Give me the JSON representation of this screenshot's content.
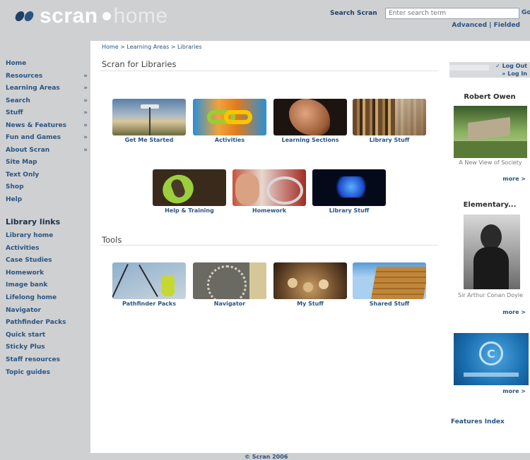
{
  "header": {
    "logo_text": "scran",
    "logo_home": "home",
    "search_label": "Search Scran",
    "search_placeholder": "Enter search term",
    "search_go": "Go",
    "links": "Advanced | Fielded"
  },
  "left_nav": {
    "items": [
      {
        "label": "Home",
        "arrow": ""
      },
      {
        "label": "Resources",
        "arrow": "»"
      },
      {
        "label": "Learning Areas",
        "arrow": "»"
      },
      {
        "label": "Search",
        "arrow": "»"
      },
      {
        "label": "Stuff",
        "arrow": "»"
      },
      {
        "label": "News & Features",
        "arrow": "»"
      },
      {
        "label": "Fun and Games",
        "arrow": "»"
      },
      {
        "label": "About Scran",
        "arrow": "»"
      },
      {
        "label": "Site Map",
        "arrow": ""
      },
      {
        "label": "Text Only",
        "arrow": ""
      },
      {
        "label": "Shop",
        "arrow": ""
      },
      {
        "label": "Help",
        "arrow": ""
      }
    ],
    "library_heading": "Library links",
    "library_items": [
      "Library home",
      "Activities",
      "Case Studies",
      "Homework",
      "Image bank",
      "Lifelong home",
      "Navigator",
      "Pathfinder Packs",
      "Quick start",
      "Sticky Plus",
      "Staff resources",
      "Topic guides"
    ]
  },
  "main": {
    "breadcrumb": "Home > Learning Areas > Libraries",
    "title": "Scran for Libraries",
    "tiles_row1": [
      "Get Me Started",
      "Activities",
      "Learning Sections",
      "Library Stuff"
    ],
    "tiles_row2": [
      "Help & Training",
      "Homework",
      "Library Stuff"
    ],
    "tools_title": "Tools",
    "tools": [
      "Pathfinder Packs",
      "Navigator",
      "My Stuff",
      "Shared Stuff"
    ]
  },
  "right": {
    "log_out": "✓ Log Out",
    "log_in": "» Log In",
    "feature1_title": "Robert Owen",
    "feature1_caption": "A New View of Society",
    "feature2_title": "Elementary...",
    "feature2_caption": "Sir Arthur Conan Doyle",
    "more": "more >",
    "features_index": "Features Index"
  },
  "footer": {
    "text": "© Scran 2006"
  },
  "colors": {
    "frame": "#cfd0d2",
    "link": "#2a5482"
  }
}
